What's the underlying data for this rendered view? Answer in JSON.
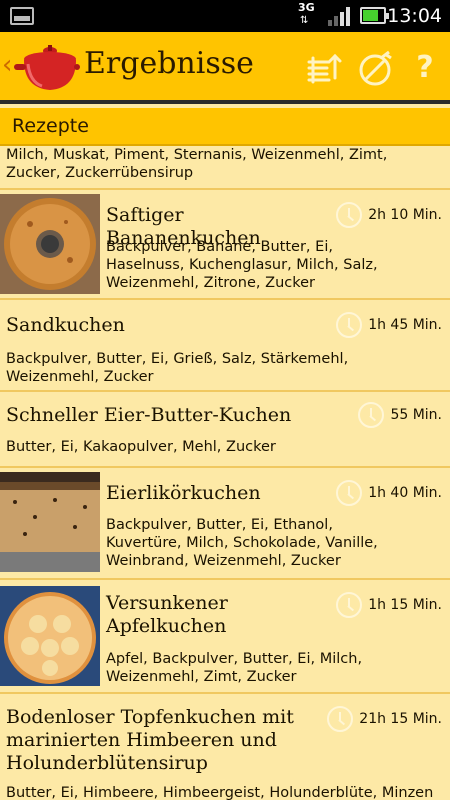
{
  "status_bar": {
    "network": "3G",
    "time": "13:04"
  },
  "action_bar": {
    "title": "Ergebnisse",
    "icons": [
      "back-chevron-icon",
      "cooking-pot-logo",
      "sort-icon",
      "no-filter-icon",
      "help-icon"
    ],
    "help_label": "?",
    "back_label": "‹"
  },
  "section": {
    "label": "Rezepte"
  },
  "recipes": [
    {
      "title": "",
      "time": "",
      "ingredients": "Milch, Muskat, Piment, Sternanis, Weizenmehl, Zimt, Zucker, Zuckerrübensirup"
    },
    {
      "title": "Saftiger Bananenkuchen",
      "time": "2h 10 Min.",
      "ingredients": "Backpulver, Banane, Butter, Ei, Haselnuss, Kuchenglasur, Milch, Salz, Weizenmehl, Zitrone, Zucker",
      "image": "bundt-cake-photo"
    },
    {
      "title": "Sandkuchen",
      "time": "1h 45 Min.",
      "ingredients": "Backpulver, Butter, Ei, Grieß, Salz, Stärkemehl, Weizenmehl, Zucker"
    },
    {
      "title": "Schneller Eier-Butter-Kuchen",
      "time": "55 Min.",
      "ingredients": "Butter, Ei, Kakaopulver, Mehl, Zucker"
    },
    {
      "title": "Eierlikörkuchen",
      "time": "1h 40 Min.",
      "ingredients": "Backpulver, Butter, Ei, Ethanol, Kuvertüre, Milch, Schokolade, Vanille, Weinbrand, Weizenmehl, Zucker",
      "image": "loaf-cake-photo"
    },
    {
      "title": "Versunkener Apfelkuchen",
      "time": "1h 15 Min.",
      "ingredients": "Apfel, Backpulver, Butter, Ei, Milch, Weizenmehl, Zimt, Zucker",
      "image": "apple-cake-photo"
    },
    {
      "title": "Bodenloser Topfenkuchen mit marinierten Himbeeren und Holunderblütensirup",
      "time": "21h 15 Min.",
      "ingredients": "Butter, Ei, Himbeere, Himbeergeist, Holunderblüte, Minzen"
    }
  ],
  "colors": {
    "action_bar": "#ffc400",
    "list_background": "#fde9a6",
    "divider": "#f0c860"
  }
}
